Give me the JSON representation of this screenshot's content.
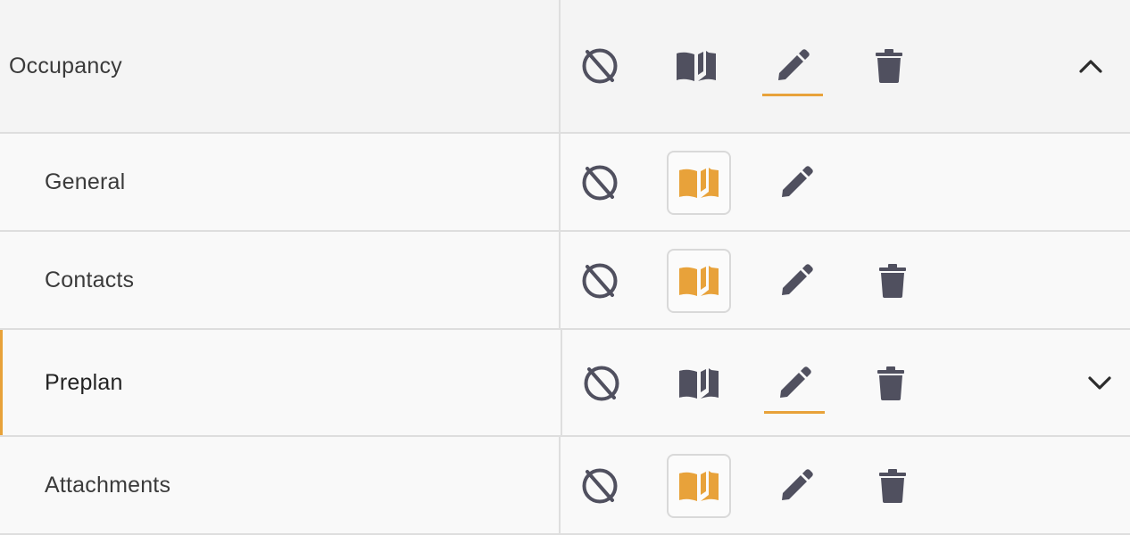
{
  "colors": {
    "accent": "#e8a23a",
    "icon": "#50505f",
    "divider": "#dedede"
  },
  "header": {
    "label": "Occupancy",
    "toggle_icon": "chevron-up-icon"
  },
  "rows": [
    {
      "label": "General",
      "read_active": true,
      "has_delete": false,
      "selected": false
    },
    {
      "label": "Contacts",
      "read_active": true,
      "has_delete": true,
      "selected": false
    },
    {
      "label": "Preplan",
      "read_active": false,
      "has_delete": true,
      "selected": true,
      "toggle_icon": "chevron-down-icon"
    },
    {
      "label": "Attachments",
      "read_active": true,
      "has_delete": true,
      "selected": false
    }
  ],
  "icons": {
    "hide": "eye-off-icon",
    "read": "book-icon",
    "edit": "pencil-icon",
    "delete": "trash-icon"
  }
}
